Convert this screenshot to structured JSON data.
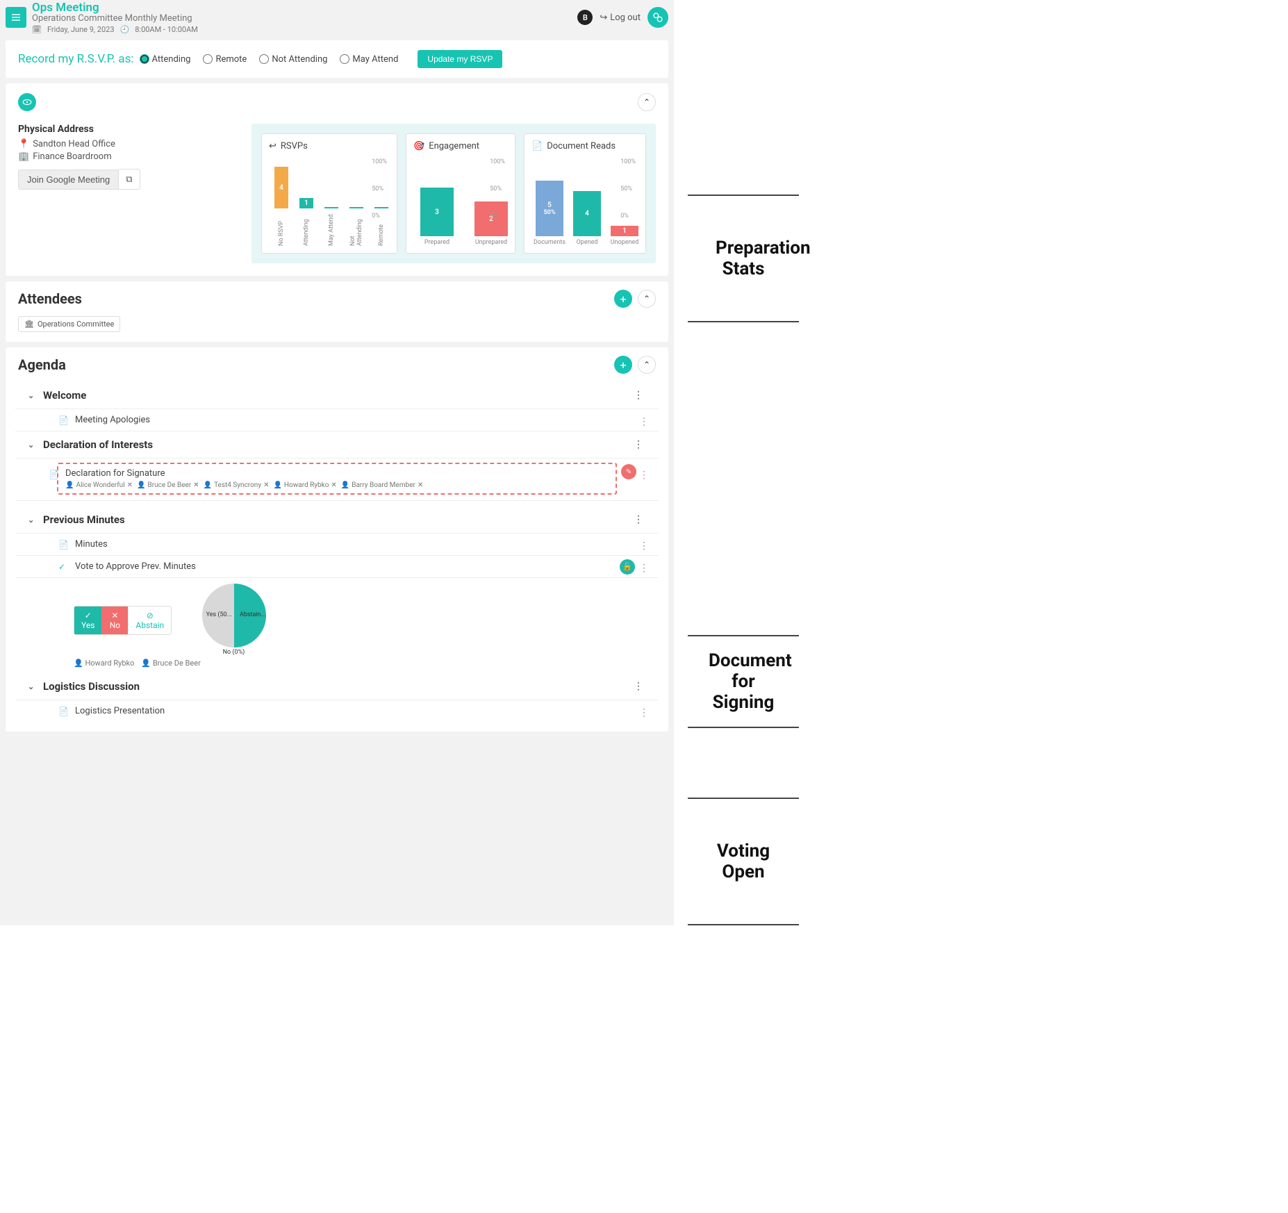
{
  "header": {
    "title": "Ops Meeting",
    "subtitle": "Operations Committee Monthly Meeting",
    "date": "Friday, June 9, 2023",
    "time": "8:00AM - 10:00AM",
    "avatar_initial": "B",
    "logout": "Log out"
  },
  "rsvp": {
    "label": "Record my R.S.V.P. as:",
    "options": [
      "Attending",
      "Remote",
      "Not Attending",
      "May Attend"
    ],
    "selected": "Attending",
    "button": "Update my RSVP"
  },
  "location": {
    "heading": "Physical Address",
    "office": "Sandton Head Office",
    "room": "Finance Boardroom",
    "join_button": "Join Google Meeting"
  },
  "stats": {
    "rsvps": {
      "title": "RSVPs",
      "bars": [
        {
          "label": "No RSVP",
          "value": 4,
          "color": "b-orange",
          "h": 60
        },
        {
          "label": "Attending",
          "value": 1,
          "color": "b-teal",
          "h": 15
        },
        {
          "label": "May Attend",
          "value": 0,
          "color": "b-teal",
          "h": 2
        },
        {
          "label": "Not Attending",
          "value": 0,
          "color": "b-teal",
          "h": 2
        },
        {
          "label": "Remote",
          "value": 0,
          "color": "b-teal",
          "h": 2
        }
      ],
      "ylabels": [
        "100%",
        "50%",
        "0%"
      ]
    },
    "engagement": {
      "title": "Engagement",
      "bars": [
        {
          "label": "Prepared",
          "value": 3,
          "color": "b-teal",
          "h": 70
        },
        {
          "label": "Unprepared",
          "value": 2,
          "color": "b-red",
          "h": 50
        }
      ],
      "ylabels": [
        "100%",
        "50%",
        "0%"
      ]
    },
    "document_reads": {
      "title": "Document Reads",
      "bars": [
        {
          "label": "Documents",
          "value": 5,
          "extra": "50%",
          "color": "b-blue",
          "h": 80
        },
        {
          "label": "Opened",
          "value": 4,
          "color": "b-teal",
          "h": 65
        },
        {
          "label": "Unopened",
          "value": 1,
          "color": "b-red",
          "h": 15
        }
      ],
      "ylabels": [
        "100%",
        "50%",
        "0%"
      ]
    }
  },
  "attendees": {
    "title": "Attendees",
    "committee": "Operations Committee"
  },
  "agenda": {
    "title": "Agenda",
    "groups": [
      {
        "title": "Welcome",
        "items": [
          {
            "title": "Meeting Apologies",
            "type": "doc"
          }
        ]
      },
      {
        "title": "Declaration of Interests",
        "items": [
          {
            "title": "Declaration for Signature",
            "type": "sign",
            "signers": [
              "Alice Wonderful",
              "Bruce De Beer",
              "Test4 Syncrony",
              "Howard Rybko",
              "Barry Board Member"
            ]
          }
        ]
      },
      {
        "title": "Previous Minutes",
        "items": [
          {
            "title": "Minutes",
            "type": "doc"
          },
          {
            "title": "Vote to Approve Prev. Minutes",
            "type": "vote",
            "options": [
              "Yes",
              "No",
              "Abstain"
            ],
            "results": {
              "yes_pct": "Yes (50...",
              "no_pct": "No (0%)",
              "abstain_pct": "Abstain..."
            },
            "voters": [
              "Howard Rybko",
              "Bruce De Beer"
            ]
          }
        ]
      },
      {
        "title": "Logistics Discussion",
        "items": [
          {
            "title": "Logistics Presentation",
            "type": "doc"
          }
        ]
      }
    ]
  },
  "annotations": {
    "prep": "Preparation Stats",
    "sign": "Document for Signing",
    "vote": "Voting Open"
  },
  "chart_data": {
    "type": "bar",
    "panels": [
      {
        "title": "RSVPs",
        "categories": [
          "No RSVP",
          "Attending",
          "May Attend",
          "Not Attending",
          "Remote"
        ],
        "values": [
          4,
          1,
          0,
          0,
          0
        ],
        "ylim": [
          0,
          100
        ],
        "yunit": "%"
      },
      {
        "title": "Engagement",
        "categories": [
          "Prepared",
          "Unprepared"
        ],
        "values": [
          3,
          2
        ],
        "ylim": [
          0,
          100
        ],
        "yunit": "%"
      },
      {
        "title": "Document Reads",
        "categories": [
          "Documents",
          "Opened",
          "Unopened"
        ],
        "values": [
          5,
          4,
          1
        ],
        "ylim": [
          0,
          100
        ],
        "yunit": "%",
        "annotations": {
          "Documents": "50%"
        }
      }
    ],
    "pie": {
      "title": "Vote to Approve Prev. Minutes",
      "slices": [
        {
          "label": "Yes",
          "pct": 50
        },
        {
          "label": "No",
          "pct": 0
        },
        {
          "label": "Abstain",
          "pct": 50
        }
      ]
    }
  }
}
